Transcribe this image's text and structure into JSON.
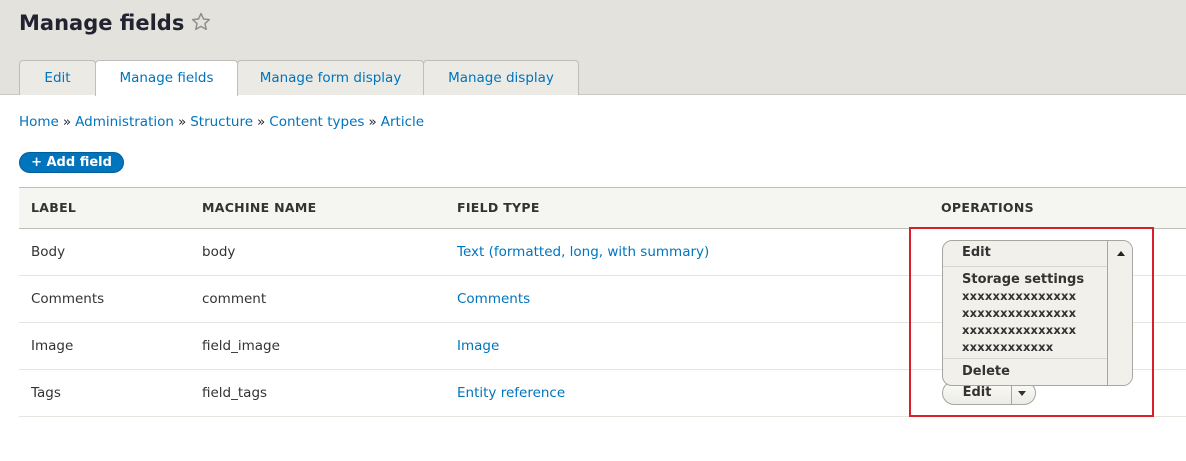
{
  "header": {
    "title": "Manage fields",
    "tabs": [
      {
        "label": "Edit",
        "active": false
      },
      {
        "label": "Manage fields",
        "active": true
      },
      {
        "label": "Manage form display",
        "active": false
      },
      {
        "label": "Manage display",
        "active": false
      }
    ]
  },
  "breadcrumb": {
    "items": [
      "Home",
      "Administration",
      "Structure",
      "Content types",
      "Article"
    ],
    "separator": "»"
  },
  "actions": {
    "add_field_label": "+ Add field"
  },
  "table": {
    "columns": [
      "LABEL",
      "MACHINE NAME",
      "FIELD TYPE",
      "OPERATIONS"
    ],
    "rows": [
      {
        "label": "Body",
        "machine_name": "body",
        "field_type": "Text (formatted, long, with summary)"
      },
      {
        "label": "Comments",
        "machine_name": "comment",
        "field_type": "Comments"
      },
      {
        "label": "Image",
        "machine_name": "field_image",
        "field_type": "Image"
      },
      {
        "label": "Tags",
        "machine_name": "field_tags",
        "field_type": "Entity reference",
        "operation": "Edit"
      }
    ]
  },
  "dropdown": {
    "edit": "Edit",
    "storage_settings": "Storage settings",
    "storage_lines": [
      "xxxxxxxxxxxxxxx",
      "xxxxxxxxxxxxxxx",
      "xxxxxxxxxxxxxxx",
      "xxxxxxxxxxxx"
    ],
    "delete": "Delete"
  },
  "colors": {
    "link": "#0074bd",
    "header_bg": "#e3e2dc",
    "primary_button": "#0074bd",
    "highlight": "#d8202a"
  }
}
